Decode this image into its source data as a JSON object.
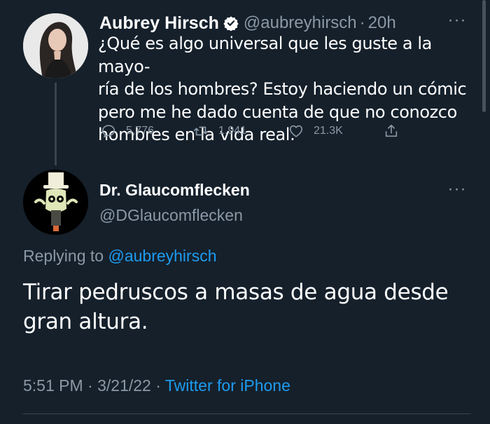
{
  "original_tweet": {
    "display_name": "Aubrey Hirsch",
    "handle": "@aubreyhirsch",
    "separator": "·",
    "time": "20h",
    "verified": true,
    "more_label": "···",
    "text_lines": [
      "¿Qué es algo universal que les guste a la mayo-",
      "ría de los hombres? Estoy haciendo un cómic",
      "pero me he dado cuenta de que no conozco",
      "hombres en la vida real."
    ],
    "replies": "5,776",
    "retweets": "1,941",
    "likes": "21.3K"
  },
  "reply_tweet": {
    "display_name": "Dr. Glaucomflecken",
    "handle": "@DGlaucomflecken",
    "more_label": "···",
    "replying_prefix": "Replying to",
    "replying_to": "@aubreyhirsch",
    "text_lines": [
      "Tirar pedruscos a masas de agua desde",
      "gran altura."
    ],
    "time": "5:51 PM",
    "date": "3/21/22",
    "separator": "·",
    "source": "Twitter for iPhone"
  },
  "colors": {
    "background": "#15202b",
    "text": "#ffffff",
    "secondary": "#8b98a5",
    "accent": "#1d9bf0",
    "divider": "#38444d"
  },
  "icons": {
    "reply": "reply-icon",
    "retweet": "retweet-icon",
    "like": "heart-icon",
    "share": "share-icon",
    "verified": "verified-badge-icon"
  }
}
